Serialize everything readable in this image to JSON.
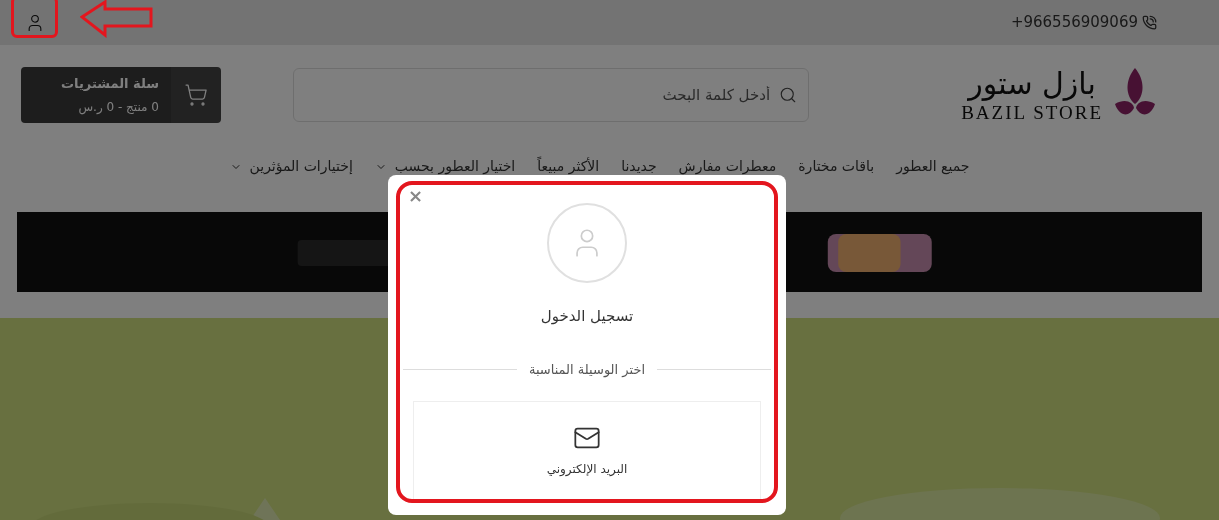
{
  "top_bar": {
    "phone": "+966556909069"
  },
  "header": {
    "logo": {
      "arabic": "بازل ستور",
      "latin": "BAZIL STORE"
    },
    "search": {
      "placeholder": "أدخل كلمة البحث"
    },
    "cart": {
      "title": "سلة المشتريات",
      "summary": "0 منتج - 0 ر.س"
    }
  },
  "nav": [
    {
      "label": "جميع العطور",
      "has_menu": false
    },
    {
      "label": "باقات مختارة",
      "has_menu": false
    },
    {
      "label": "معطرات مفارش",
      "has_menu": false
    },
    {
      "label": "جديدنا",
      "has_menu": false
    },
    {
      "label": "الأكثر مبيعاً",
      "has_menu": false
    },
    {
      "label": "اختيار العطور بحسب",
      "has_menu": true
    },
    {
      "label": "إختيارات المؤثرين",
      "has_menu": true
    }
  ],
  "modal": {
    "close": "×",
    "title": "تسجيل الدخول",
    "divider_text": "اختر الوسيلة المناسبة",
    "options": [
      {
        "kind": "email",
        "label": "البريد الإلكتروني"
      }
    ]
  }
}
